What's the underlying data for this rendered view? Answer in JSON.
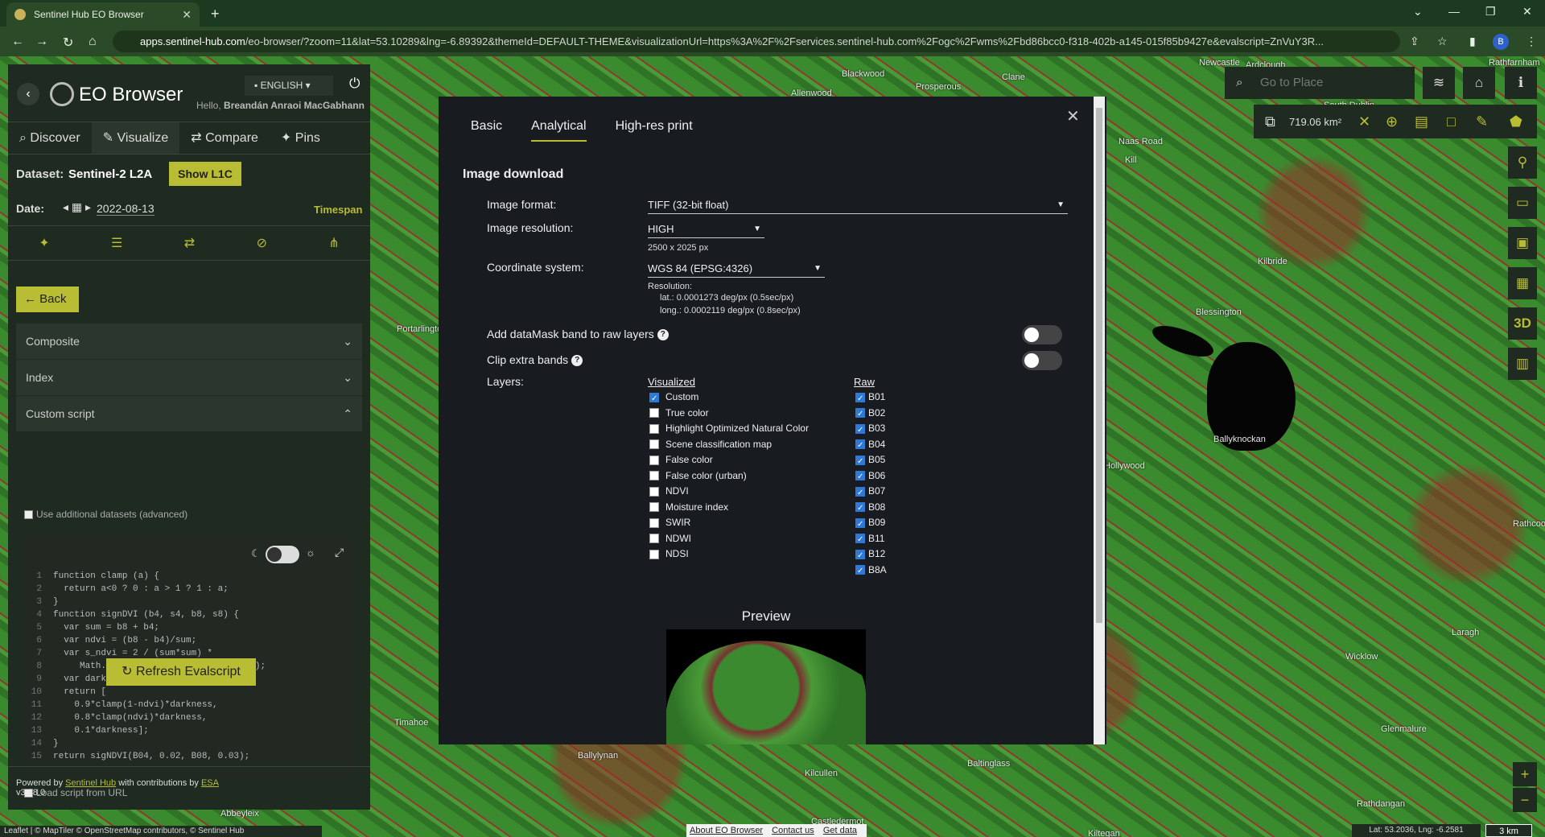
{
  "browser": {
    "tab_title": "Sentinel Hub EO Browser",
    "url_host": "apps.sentinel-hub.com",
    "url_path": "/eo-browser/?zoom=11&lat=53.10289&lng=-6.89392&themeId=DEFAULT-THEME&visualizationUrl=https%3A%2F%2Fservices.sentinel-hub.com%2Fogc%2Fwms%2Fbd86bcc0-f318-402b-a145-015f85b9427e&evalscript=ZnVuY3R...",
    "profile_initial": "B"
  },
  "sidebar": {
    "app_title": "EO Browser",
    "language": "ENGLISH",
    "hello_prefix": "Hello,",
    "user_name": "Breandán Anraoi MacGabhann",
    "tabs": [
      {
        "icon": "search-icon",
        "label": "Discover"
      },
      {
        "icon": "brush-icon",
        "label": "Visualize"
      },
      {
        "icon": "compare-icon",
        "label": "Compare"
      },
      {
        "icon": "pin-icon",
        "label": "Pins"
      }
    ],
    "dataset_label": "Dataset:",
    "dataset_value": "Sentinel-2 L2A",
    "show_l1c": "Show L1C",
    "date_label": "Date:",
    "date_value": "2022-08-13",
    "timespan": "Timespan",
    "back": "Back",
    "accordions": [
      "Composite",
      "Index",
      "Custom script"
    ],
    "use_additional": "Use additional datasets (advanced)",
    "code_lines": [
      "function clamp (a) {",
      "  return a<0 ? 0 : a > 1 ? 1 : a;",
      "}",
      "function signDVI (b4, s4, b8, s8) {",
      "  var sum = b8 + b4;",
      "  var ndvi = (b8 - b4)/sum;",
      "  var s_ndvi = 2 / (sum*sum) *",
      "     Math.sqrt(b8*b8*s4*s4+b4*b4*s8*s8);",
      "  var darkness = clamp(1-2*s_ndvi);",
      "  return [",
      "    0.9*clamp(1-ndvi)*darkness,",
      "    0.8*clamp(ndvi)*darkness,",
      "    0.1*darkness];",
      "}",
      "return sigNDVI(B04, 0.02, B08, 0.03);"
    ],
    "load_url": "Load script from URL",
    "refresh": "Refresh Evalscript",
    "powered_by": "Powered by",
    "sentinel_hub": "Sentinel Hub",
    "with_contrib": "with contributions by",
    "esa": "ESA",
    "version": "v3.38.0"
  },
  "modal": {
    "tabs": [
      "Basic",
      "Analytical",
      "High-res print"
    ],
    "active_tab": "Analytical",
    "section_title": "Image download",
    "image_format_label": "Image format:",
    "image_format_value": "TIFF (32-bit float)",
    "image_resolution_label": "Image resolution:",
    "image_resolution_value": "HIGH",
    "image_resolution_px": "2500 x 2025 px",
    "coord_label": "Coordinate system:",
    "coord_value": "WGS 84 (EPSG:4326)",
    "resolution_title": "Resolution:",
    "res_lat": "lat.: 0.0001273 deg/px (0.5sec/px)",
    "res_long": "long.: 0.0002119 deg/px (0.8sec/px)",
    "datamask_label": "Add dataMask band to raw layers",
    "clip_label": "Clip extra bands",
    "layers_label": "Layers:",
    "visualized_head": "Visualized",
    "raw_head": "Raw",
    "visualized": [
      {
        "label": "Custom",
        "checked": true
      },
      {
        "label": "True color",
        "checked": false
      },
      {
        "label": "Highlight Optimized Natural Color",
        "checked": false
      },
      {
        "label": "Scene classification map",
        "checked": false
      },
      {
        "label": "False color",
        "checked": false
      },
      {
        "label": "False color (urban)",
        "checked": false
      },
      {
        "label": "NDVI",
        "checked": false
      },
      {
        "label": "Moisture index",
        "checked": false
      },
      {
        "label": "SWIR",
        "checked": false
      },
      {
        "label": "NDWI",
        "checked": false
      },
      {
        "label": "NDSI",
        "checked": false
      }
    ],
    "raw": [
      "B01",
      "B02",
      "B03",
      "B04",
      "B05",
      "B06",
      "B07",
      "B08",
      "B09",
      "B11",
      "B12",
      "B8A"
    ],
    "preview_title": "Preview"
  },
  "map": {
    "goto_placeholder": "Go to Place",
    "area": "719.06 km²",
    "places": [
      "Ardclough",
      "Newcastle",
      "Rathfarnham",
      "Blackwood",
      "Clane",
      "Prosperous",
      "Allenwood",
      "Naas Road",
      "Kill",
      "South Dublin",
      "Kilbride",
      "Blessington",
      "Portarlington",
      "Ballyknockan",
      "Hollywood",
      "Laragh",
      "Wicklow",
      "Glenmalure",
      "Timahoe",
      "Ballylynan",
      "Baltinglass",
      "Rathdangan",
      "Abbeyleix",
      "Castledermot",
      "Kiltegan",
      "Kilcullen",
      "Rathcoole"
    ],
    "attribution": "Leaflet | © MapTiler © OpenStreetMap contributors, © Sentinel Hub",
    "footer_links": [
      "About EO Browser",
      "Contact us",
      "Get data"
    ],
    "coords": "Lat: 53.2036, Lng: -6.2581",
    "scale": "3 km"
  }
}
